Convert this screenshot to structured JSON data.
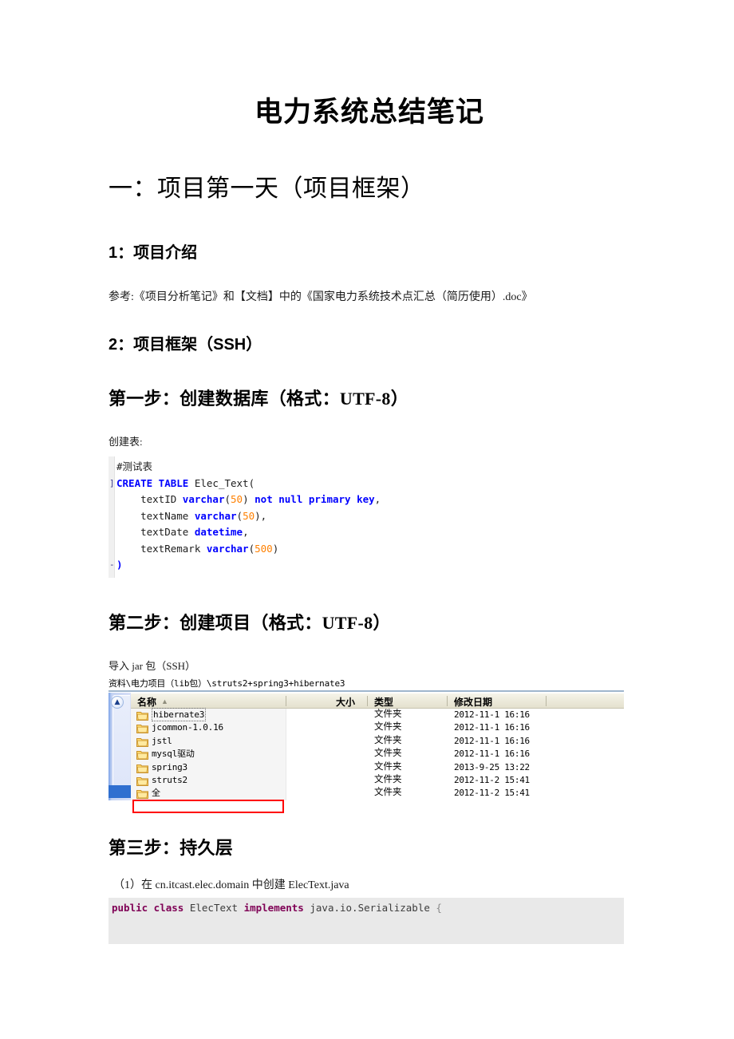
{
  "document": {
    "title": "电力系统总结笔记",
    "heading_1": "一：项目第一天（项目框架）",
    "section_1_heading": "1：项目介绍",
    "section_1_text": "参考:《项目分析笔记》和【文档】中的《国家电力系统技术点汇总（简历使用）.doc》",
    "section_2_heading": "2：项目框架（SSH）",
    "step_1_heading": "第一步：创建数据库（格式：UTF-8）",
    "step_1_caption": "创建表:",
    "step_2_heading": "第二步：创建项目（格式：UTF-8）",
    "step_2_caption": "导入 jar 包（SSH）",
    "step_3_heading": "第三步：持久层",
    "step_3_caption": "（1）在 cn.itcast.elec.domain 中创建 ElecText.java"
  },
  "sql_code": {
    "fold_marks": [
      "",
      "]",
      "",
      "",
      "",
      "",
      "-"
    ],
    "lines": [
      [
        {
          "t": "#测试表",
          "c": "plain"
        }
      ],
      [
        {
          "t": "CREATE TABLE ",
          "c": "kw"
        },
        {
          "t": "Elec_Text(",
          "c": "plain"
        }
      ],
      [
        {
          "t": "    textID ",
          "c": "plain"
        },
        {
          "t": "varchar",
          "c": "kw"
        },
        {
          "t": "(",
          "c": "plain"
        },
        {
          "t": "50",
          "c": "num"
        },
        {
          "t": ") ",
          "c": "plain"
        },
        {
          "t": "not null primary key",
          "c": "kw"
        },
        {
          "t": ",",
          "c": "plain"
        }
      ],
      [
        {
          "t": "    textName ",
          "c": "plain"
        },
        {
          "t": "varchar",
          "c": "kw"
        },
        {
          "t": "(",
          "c": "plain"
        },
        {
          "t": "50",
          "c": "num"
        },
        {
          "t": "),",
          "c": "plain"
        }
      ],
      [
        {
          "t": "    textDate ",
          "c": "plain"
        },
        {
          "t": "datetime",
          "c": "kw"
        },
        {
          "t": ",",
          "c": "plain"
        }
      ],
      [
        {
          "t": "    textRemark ",
          "c": "plain"
        },
        {
          "t": "varchar",
          "c": "kw"
        },
        {
          "t": "(",
          "c": "plain"
        },
        {
          "t": "500",
          "c": "num"
        },
        {
          "t": ")",
          "c": "plain"
        }
      ],
      [
        {
          "t": ")",
          "c": "brace"
        }
      ]
    ],
    "keyword_color": "#0000ff",
    "number_color": "#ff8000"
  },
  "explorer": {
    "path": "资料\\电力项目（lib包）\\struts2+spring3+hibernate3",
    "collapse_icon": "chevron-up-icon",
    "columns": [
      {
        "label": "名称",
        "sorted": true,
        "sort_glyph": "▲"
      },
      {
        "label": "大小"
      },
      {
        "label": "类型"
      },
      {
        "label": "修改日期"
      }
    ],
    "rows": [
      {
        "name": "hibernate3",
        "size": "",
        "type": "文件夹",
        "date": "2012-11-1 16:16",
        "focused": true,
        "highlighted": false
      },
      {
        "name": "jcommon-1.0.16",
        "size": "",
        "type": "文件夹",
        "date": "2012-11-1 16:16",
        "focused": false,
        "highlighted": false
      },
      {
        "name": "jstl",
        "size": "",
        "type": "文件夹",
        "date": "2012-11-1 16:16",
        "focused": false,
        "highlighted": false
      },
      {
        "name": "mysql驱动",
        "size": "",
        "type": "文件夹",
        "date": "2012-11-1 16:16",
        "focused": false,
        "highlighted": false
      },
      {
        "name": "spring3",
        "size": "",
        "type": "文件夹",
        "date": "2013-9-25 13:22",
        "focused": false,
        "highlighted": false
      },
      {
        "name": "struts2",
        "size": "",
        "type": "文件夹",
        "date": "2012-11-2 15:41",
        "focused": false,
        "highlighted": false
      },
      {
        "name": "全",
        "size": "",
        "type": "文件夹",
        "date": "2012-11-2 15:41",
        "focused": false,
        "highlighted": true
      }
    ],
    "highlight_color": "#ff0000",
    "selection_color": "#2f6fd0"
  },
  "java_code": {
    "segments": [
      {
        "t": "public class ",
        "c": "jkw"
      },
      {
        "t": "ElecText ",
        "c": "jplain"
      },
      {
        "t": "implements ",
        "c": "jkw"
      },
      {
        "t": "java.io.Serializable ",
        "c": "jplain"
      },
      {
        "t": "{",
        "c": "jbrace"
      }
    ],
    "keyword_color": "#7f0055",
    "background": "#e9e9e9"
  }
}
